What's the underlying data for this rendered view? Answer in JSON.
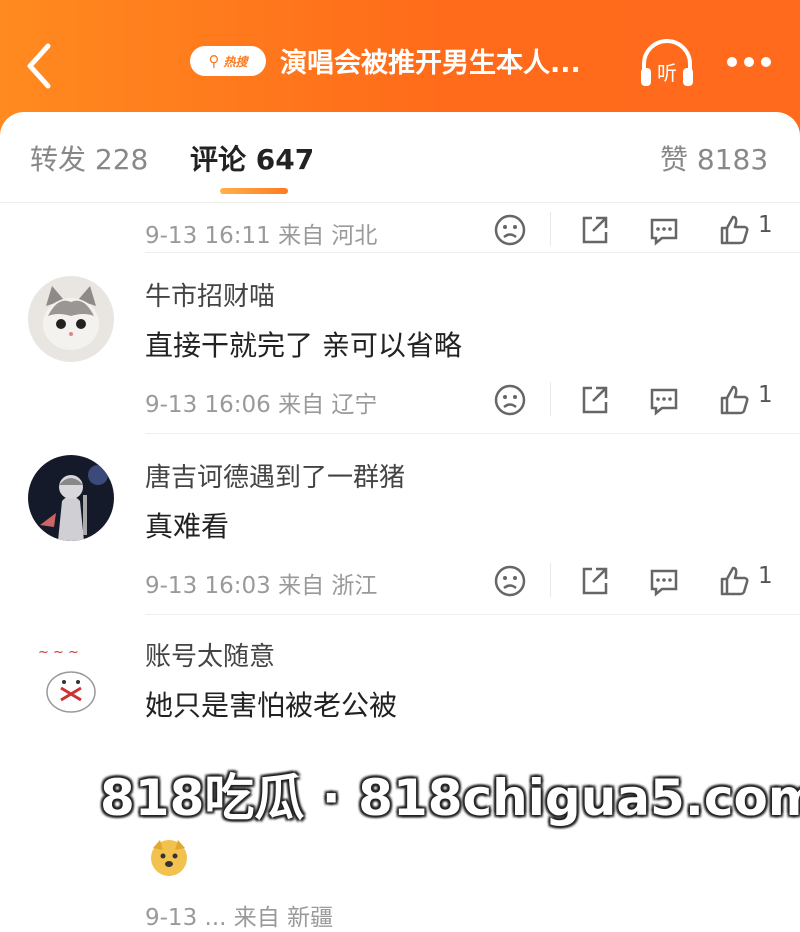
{
  "header": {
    "hot_badge": "热搜",
    "title": "演唱会被推开男生本人...",
    "listen_label": "听"
  },
  "tabs": {
    "repost": "转发 228",
    "comment": "评论 647",
    "like": "赞 8183"
  },
  "comments": [
    {
      "meta": "9-13 16:11 来自 河北",
      "likes": "1"
    },
    {
      "username": "牛市招财喵",
      "text": "直接干就完了 亲可以省略",
      "meta": "9-13 16:06 来自 辽宁",
      "likes": "1"
    },
    {
      "username": "唐吉诃德遇到了一群猪",
      "text": "真难看",
      "meta": "9-13 16:03 来自 浙江",
      "likes": "1"
    },
    {
      "username": "账号太随意",
      "text": "她只是害怕被老公被",
      "meta": "9-13 ... 来自 新疆",
      "likes": ""
    }
  ],
  "watermark": "818吃瓜 · 818chigua5.com",
  "colors": {
    "accent": "#ff7a1f",
    "header_bg": "#ff6b1a"
  }
}
